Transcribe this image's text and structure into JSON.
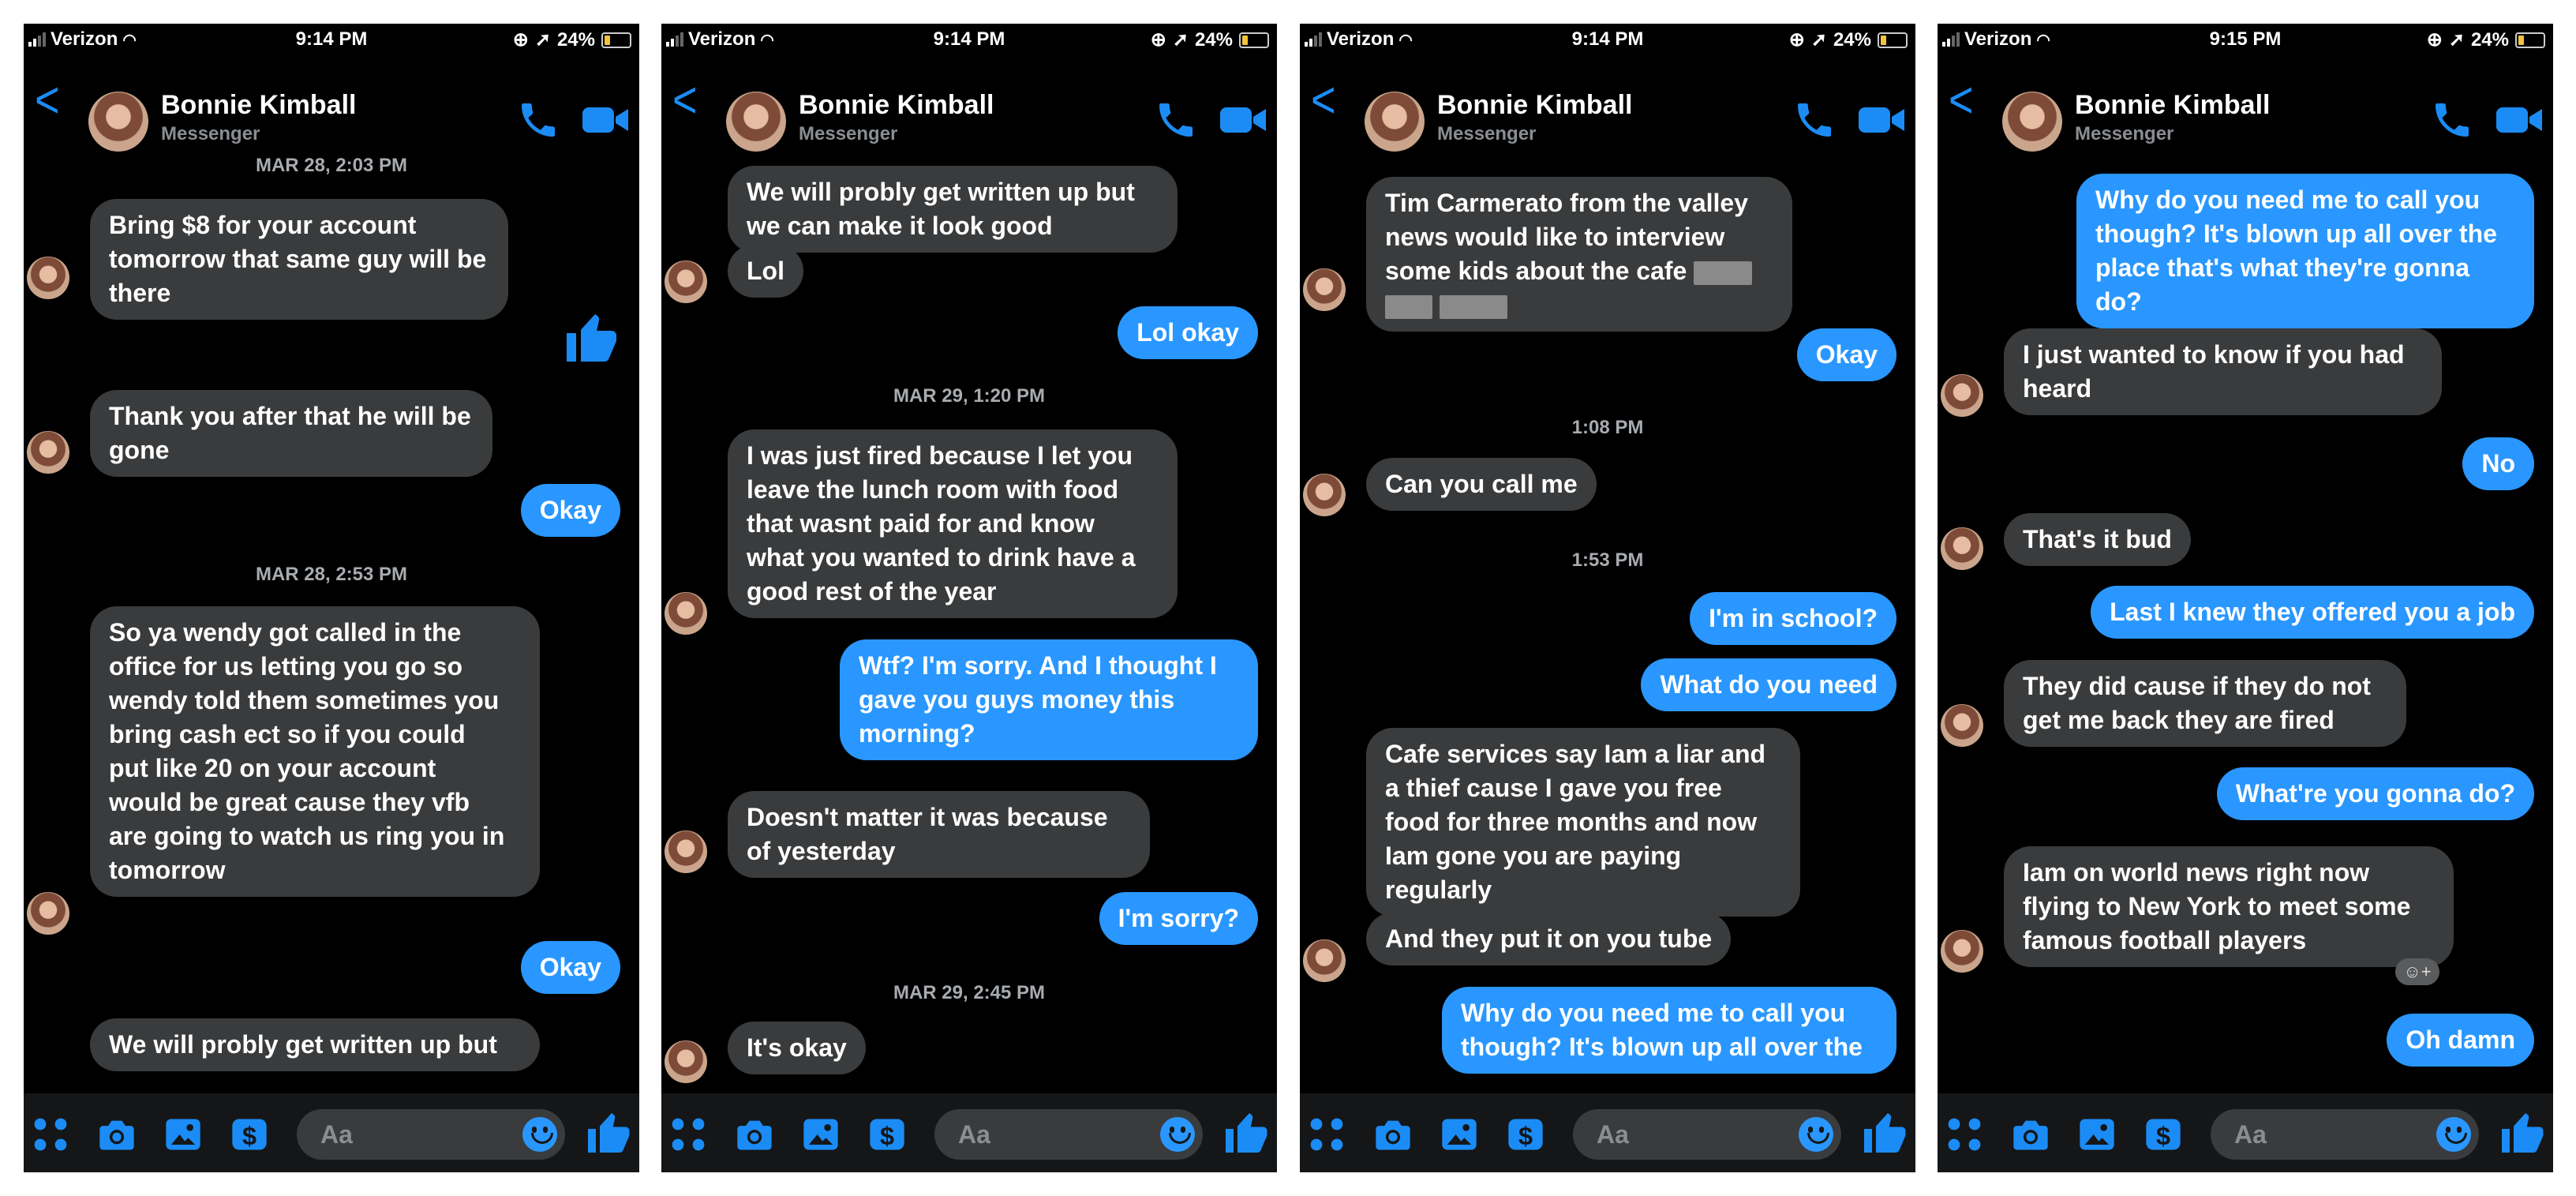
{
  "colors": {
    "accent": "#2997ff",
    "incoming": "#3a3b3c",
    "background": "#000000"
  },
  "screens": [
    {
      "status": {
        "carrier": "Verizon",
        "time": "9:14 PM",
        "battery": "24%"
      },
      "contact": {
        "name": "Bonnie Kimball",
        "subtitle": "Messenger"
      },
      "composer": {
        "placeholder": "Aa"
      },
      "messages": [
        {
          "kind": "timestamp",
          "text": "MAR 28, 2:03 PM"
        },
        {
          "kind": "in",
          "text": "Bring $8 for your account\ntomorrow that same guy will be\nthere"
        },
        {
          "kind": "like",
          "text": "like-thumbs-up-icon"
        },
        {
          "kind": "in",
          "text": "Thank you after that he will be\ngone"
        },
        {
          "kind": "out",
          "text": "Okay"
        },
        {
          "kind": "timestamp",
          "text": "MAR 28, 2:53 PM"
        },
        {
          "kind": "in",
          "text": "So ya wendy got called in the\noffice for us letting you go so\nwendy told them sometimes you\nbring cash ect so if you could\nput like 20 on your account\nwould be great cause they vfb\nare going to watch us ring you in\ntomorrow"
        },
        {
          "kind": "out",
          "text": "Okay"
        },
        {
          "kind": "in",
          "text": "We will probly get written up but"
        }
      ]
    },
    {
      "status": {
        "carrier": "Verizon",
        "time": "9:14 PM",
        "battery": "24%"
      },
      "contact": {
        "name": "Bonnie Kimball",
        "subtitle": "Messenger"
      },
      "composer": {
        "placeholder": "Aa"
      },
      "messages": [
        {
          "kind": "in",
          "text": "We will probly get written up but\nwe can make it look good"
        },
        {
          "kind": "in",
          "text": "Lol"
        },
        {
          "kind": "out",
          "text": "Lol okay"
        },
        {
          "kind": "timestamp",
          "text": "MAR 29, 1:20 PM"
        },
        {
          "kind": "in",
          "text": "I was just fired because I let you\nleave the lunch room with food\nthat wasnt paid for and know\nwhat you wanted to drink have a\ngood rest of the year"
        },
        {
          "kind": "out",
          "text": "Wtf? I'm sorry. And I thought I\ngave you guys money this\nmorning?"
        },
        {
          "kind": "in",
          "text": "Doesn't matter it was because\nof yesterday"
        },
        {
          "kind": "out",
          "text": "I'm sorry?"
        },
        {
          "kind": "timestamp",
          "text": "MAR 29, 2:45 PM"
        },
        {
          "kind": "in",
          "text": "It's okay"
        }
      ]
    },
    {
      "status": {
        "carrier": "Verizon",
        "time": "9:14 PM",
        "battery": "24%"
      },
      "contact": {
        "name": "Bonnie Kimball",
        "subtitle": "Messenger"
      },
      "composer": {
        "placeholder": "Aa"
      },
      "messages": [
        {
          "kind": "in",
          "text": "Tim Carmerato from the valley\nnews would like to interview\nsome kids about the cafe"
        },
        {
          "kind": "out",
          "text": "Okay"
        },
        {
          "kind": "timestamp",
          "text": "1:08 PM"
        },
        {
          "kind": "in",
          "text": "Can you call me"
        },
        {
          "kind": "timestamp",
          "text": "1:53 PM"
        },
        {
          "kind": "out",
          "text": "I'm in school?"
        },
        {
          "kind": "out",
          "text": "What do you need"
        },
        {
          "kind": "in",
          "text": "Cafe services say Iam a liar and\na thief cause I gave you free\nfood for three months and now\nIam gone you are paying\nregularly"
        },
        {
          "kind": "in",
          "text": "And they put it on you tube"
        },
        {
          "kind": "out",
          "text": "Why do you need me to call you\nthough? It's blown up all over the"
        }
      ]
    },
    {
      "status": {
        "carrier": "Verizon",
        "time": "9:15 PM",
        "battery": "24%"
      },
      "contact": {
        "name": "Bonnie Kimball",
        "subtitle": "Messenger"
      },
      "composer": {
        "placeholder": "Aa"
      },
      "messages": [
        {
          "kind": "out",
          "text": "Why do you need me to call you\nthough? It's blown up all over the\nplace that's what they're gonna\ndo?"
        },
        {
          "kind": "in",
          "text": "I just wanted to know if you had\nheard"
        },
        {
          "kind": "out",
          "text": "No"
        },
        {
          "kind": "in",
          "text": "That's it bud"
        },
        {
          "kind": "out",
          "text": "Last I knew they offered you a job"
        },
        {
          "kind": "in",
          "text": "They did cause if they do not\nget me back they are fired"
        },
        {
          "kind": "out",
          "text": "What're you gonna do?"
        },
        {
          "kind": "in",
          "text": "Iam on world news right now\nflying to New York to meet some\nfamous football players"
        },
        {
          "kind": "out",
          "text": "Oh damn"
        }
      ]
    }
  ]
}
